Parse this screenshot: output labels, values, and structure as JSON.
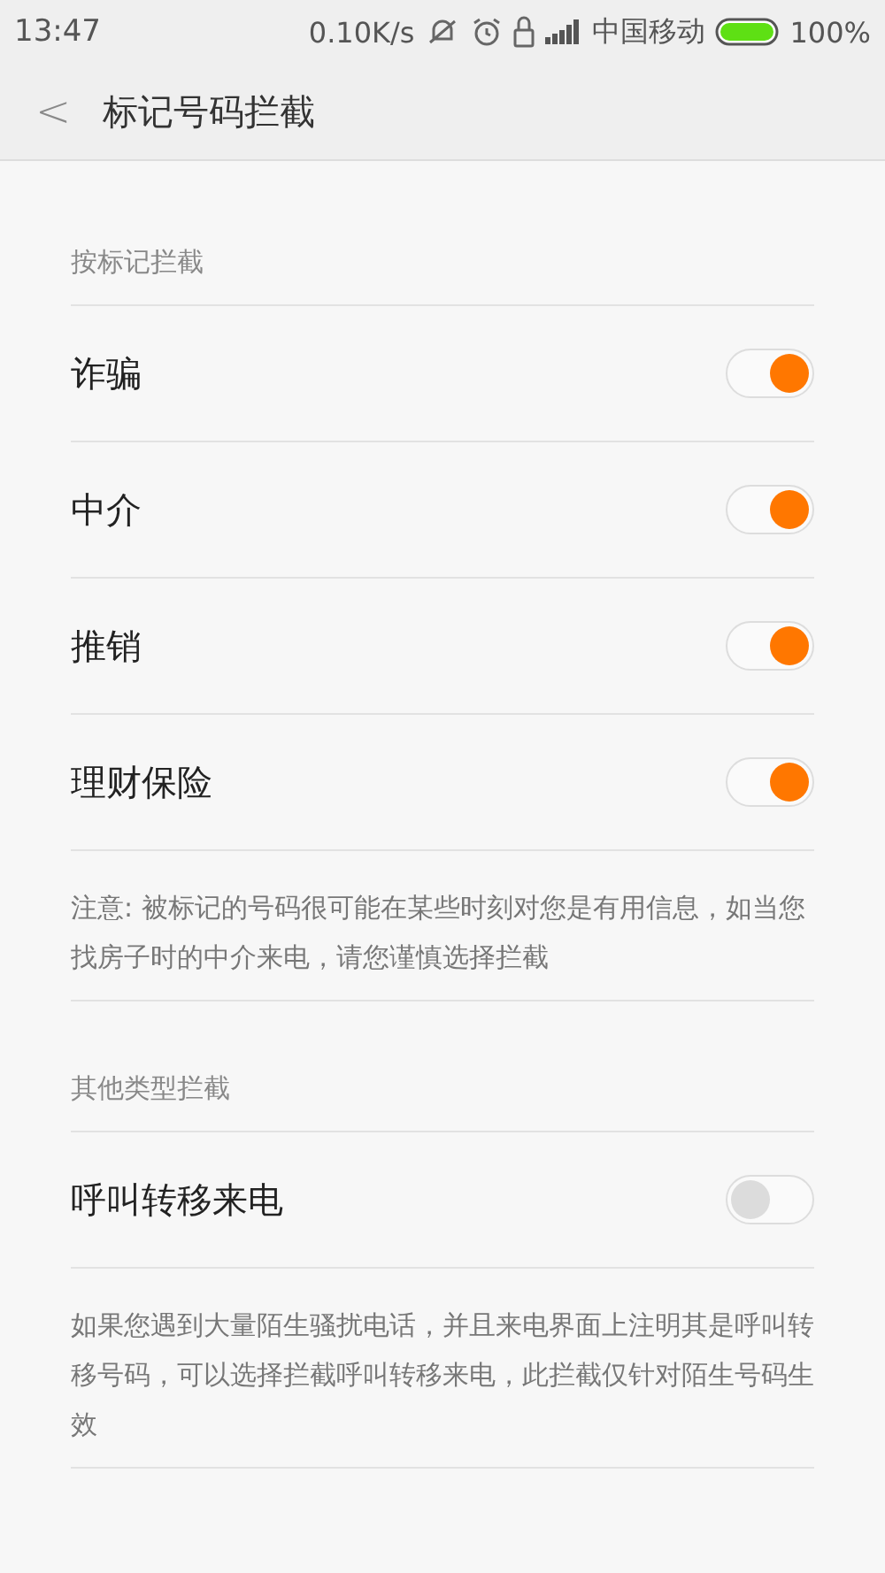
{
  "status_bar": {
    "time": "13:47",
    "speed": "0.10K/s",
    "carrier": "中国移动",
    "battery": "100%"
  },
  "header": {
    "back": "<",
    "title": "标记号码拦截"
  },
  "sections": [
    {
      "title": "按标记拦截",
      "items": [
        {
          "label": "诈骗",
          "on": true
        },
        {
          "label": "中介",
          "on": true
        },
        {
          "label": "推销",
          "on": true
        },
        {
          "label": "理财保险",
          "on": true
        }
      ],
      "note": "注意: 被标记的号码很可能在某些时刻对您是有用信息，如当您找房子时的中介来电，请您谨慎选择拦截"
    },
    {
      "title": "其他类型拦截",
      "items": [
        {
          "label": "呼叫转移来电",
          "on": false
        }
      ],
      "note": "如果您遇到大量陌生骚扰电话，并且来电界面上注明其是呼叫转移号码，可以选择拦截呼叫转移来电，此拦截仅针对陌生号码生效"
    }
  ]
}
